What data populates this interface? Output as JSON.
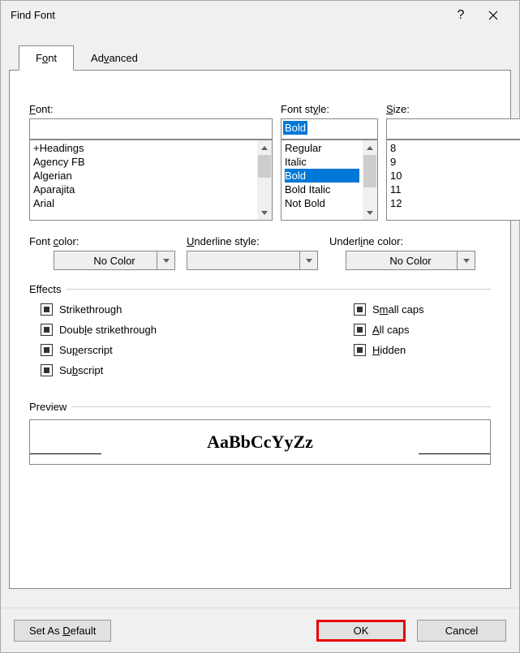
{
  "title": "Find Font",
  "tabs": {
    "font": "Font",
    "advanced": "Advanced"
  },
  "labels": {
    "font": "Font:",
    "fontstyle": "Font style:",
    "size": "Size:",
    "fontcolor": "Font color:",
    "underlinestyle": "Underline style:",
    "underlinecolor": "Underline color:"
  },
  "font_value": "",
  "fontstyle_value": "Bold",
  "size_value": "",
  "font_list": [
    "+Headings",
    "Agency FB",
    "Algerian",
    "Aparajita",
    "Arial"
  ],
  "fontstyle_list": [
    "Regular",
    "Italic",
    "Bold",
    "Bold Italic",
    "Not Bold"
  ],
  "fontstyle_selected": "Bold",
  "size_list": [
    "8",
    "9",
    "10",
    "11",
    "12"
  ],
  "dropdowns": {
    "fontcolor": "No Color",
    "underlinestyle": "",
    "underlinecolor": "No Color"
  },
  "effects": {
    "legend": "Effects",
    "left": [
      "Strikethrough",
      "Double strikethrough",
      "Superscript",
      "Subscript"
    ],
    "right": [
      "Small caps",
      "All caps",
      "Hidden"
    ]
  },
  "preview": {
    "legend": "Preview",
    "text": "AaBbCcYyZz"
  },
  "buttons": {
    "default": "Set As Default",
    "ok": "OK",
    "cancel": "Cancel"
  }
}
